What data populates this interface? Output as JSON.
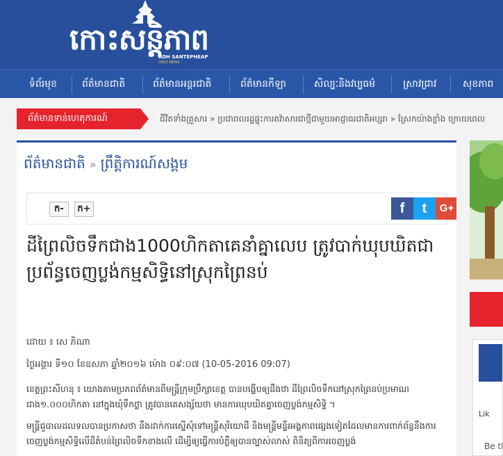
{
  "header": {
    "logo_text": "កោះសន្តិភាព",
    "logo_sub": "KOH SANTEPHEAP",
    "logo_sub2": "DAILY NEWS"
  },
  "nav": {
    "items": [
      {
        "label": "ទំព័រមុខ"
      },
      {
        "label": "ព័ត៌មានជាតិ"
      },
      {
        "label": "ព័ត៌មានអន្តរជាតិ"
      },
      {
        "label": "ព័ត៌មានកីឡា"
      },
      {
        "label": "សិល្បៈនិងវប្បធម៌"
      },
      {
        "label": "ស្រាវជ្រាវ"
      },
      {
        "label": "សុខភាព"
      }
    ]
  },
  "ticker": {
    "label": "ព័ត៌មានទាន់ហេតុការណ៍",
    "text": "ជីវិតទាំងគ្រួសារ » ប្រជាពលរដ្ឋផ្ទុះការតវ៉ាសារជាថ្មីជាមួយអាជ្ញាធរជាតិអប្សរា » ស្រែកយ៉ាងខ្លាំង ក្រោយពេល"
  },
  "breadcrumb": {
    "section": "ព័ត៌មានជាតិ",
    "separator": "»",
    "subsection": "ព្រឹត្តិការណ៍សង្គម"
  },
  "toolbar": {
    "font_decrease": "ក-",
    "font_increase": "ក+",
    "facebook": "f",
    "twitter": "t",
    "googleplus": "G+"
  },
  "article": {
    "title": "ដីព្រៃលិចទឹកជាង1000ហិកតាគេនាំគ្នាលេប ត្រូវបាក់ឃុបឃិតជាប្រព័ន្ធចេញប្លង់កម្មសិទ្ធិនៅស្រុកព្រៃនប់",
    "byline": "ដោយ ៖ សេ ភិណា",
    "date": "ថ្ងៃអង្គារ ទី១០ ខែឧសភា ឆ្នាំ២០១៦ ម៉ោង ០៩:០៧   (10-05-2016 09:07)",
    "para1": "ខេត្តព្រះសីហនុ ៖ យោងតាមប្រភពព័ត៌មានពីមន្ត្រីក្រុមប្រឹក្សាខេត្ត បានបង្ហើបឲ្យដឹងថា ដីព្រៃលិចទឹកនៅស្រុកព្រៃនប់ប្រមាណជាង១.០០០ហិកតា នៅក្នុងឃុំទឹកថ្លា ត្រូវបានគេសង្ស័យថា មានការឃុបឃិតគ្នាចេញប្លង់កម្មសិទ្ធិ ។",
    "para2": "មន្ត្រីជួបាលដលទលបានប្រកាសថា នឹងដាក់ការស្នើសុំទៅមន្ត្រីសុរិយោដី និងមន្ត្រីមន្ទីរអង្គភាពផ្សេងទៀតដែលមានការពាក់ព័ន្ធនឹងការចេញប្លង់កម្មសិទ្ធិលើដីតំបន់ព្រៃលិចទឹកខាងលើ ដើម្បីឲ្យធ្វើការបំភ្លឺឲ្យបានច្បាស់លាស់ ពិនិត្យពីការចេញប្លង់"
  },
  "sidebar": {
    "fb_text": "Lik",
    "be_text": "Be th"
  },
  "colors": {
    "brand_blue": "#274f9b",
    "nav_blue": "#2a56a8",
    "accent_red": "#e5232c",
    "facebook": "#3b5998",
    "twitter": "#1da1f2",
    "googleplus": "#dd4b39"
  }
}
